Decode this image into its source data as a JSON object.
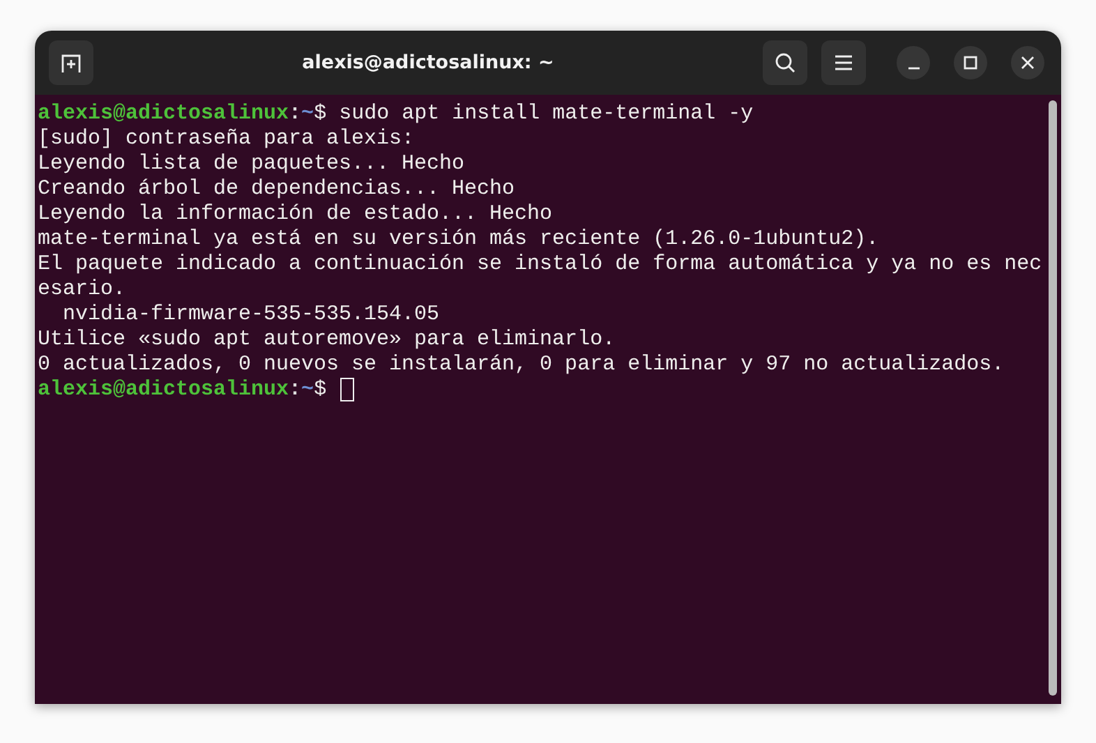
{
  "window": {
    "title": "alexis@adictosalinux: ~"
  },
  "terminal": {
    "lines": [
      {
        "kind": "prompt",
        "user": "alexis@adictosalinux",
        "separator": ":",
        "path": "~",
        "symbol": "$",
        "command": " sudo apt install mate-terminal -y",
        "cursor": false
      },
      {
        "kind": "output",
        "text": "[sudo] contraseña para alexis:"
      },
      {
        "kind": "output",
        "text": "Leyendo lista de paquetes... Hecho"
      },
      {
        "kind": "output",
        "text": "Creando árbol de dependencias... Hecho"
      },
      {
        "kind": "output",
        "text": "Leyendo la información de estado... Hecho"
      },
      {
        "kind": "output",
        "text": "mate-terminal ya está en su versión más reciente (1.26.0-1ubuntu2)."
      },
      {
        "kind": "output",
        "text": "El paquete indicado a continuación se instaló de forma automática y ya no es nec"
      },
      {
        "kind": "output",
        "text": "esario."
      },
      {
        "kind": "output",
        "text": "  nvidia-firmware-535-535.154.05"
      },
      {
        "kind": "output",
        "text": "Utilice «sudo apt autoremove» para eliminarlo."
      },
      {
        "kind": "output",
        "text": "0 actualizados, 0 nuevos se instalarán, 0 para eliminar y 97 no actualizados."
      },
      {
        "kind": "prompt",
        "user": "alexis@adictosalinux",
        "separator": ":",
        "path": "~",
        "symbol": "$",
        "cursor": true
      }
    ]
  }
}
